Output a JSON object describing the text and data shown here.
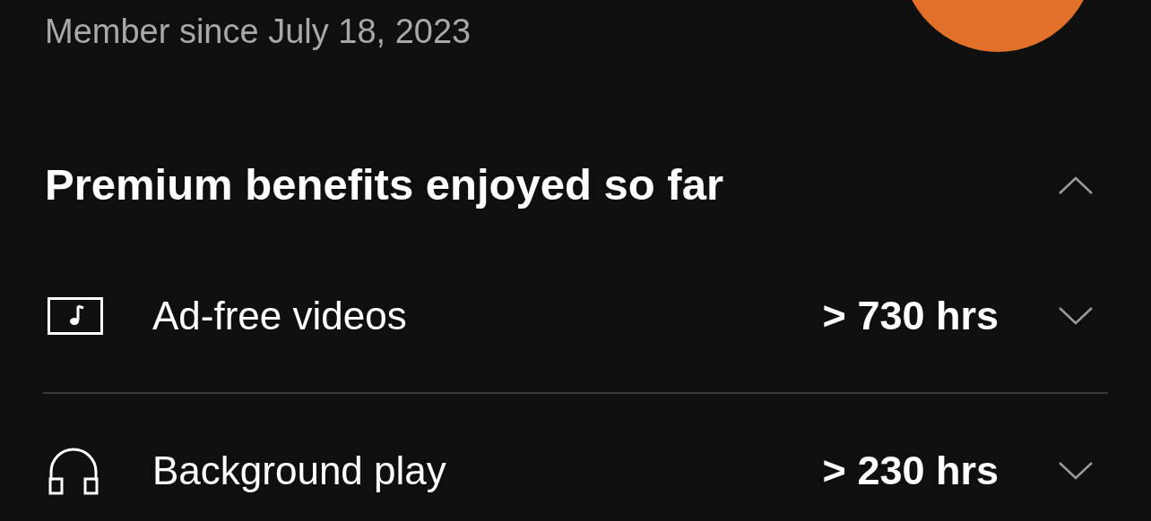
{
  "profile": {
    "member_since": "Member since July 18, 2023"
  },
  "benefits": {
    "title": "Premium benefits enjoyed so far",
    "expanded": true,
    "items": [
      {
        "kind": "video",
        "label": "Ad-free videos",
        "value": "> 730 hrs",
        "expanded": false
      },
      {
        "kind": "audio",
        "label": "Background play",
        "value": "> 230 hrs",
        "expanded": false
      }
    ]
  }
}
